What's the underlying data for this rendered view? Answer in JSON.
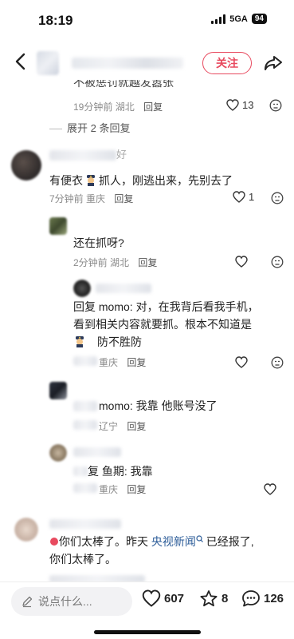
{
  "status": {
    "time": "18:19",
    "network": "5GA",
    "battery": "94"
  },
  "header": {
    "follow_label": "关注"
  },
  "comments": {
    "c0": {
      "text_partial": "不被惩罚就越发嚣张",
      "time": "19分钟前",
      "region": "湖北",
      "reply": "回复",
      "likes": "13"
    },
    "expand": {
      "label": "展开 2 条回复"
    },
    "c1": {
      "user_tail": "好",
      "text_a": "有便衣",
      "text_b": "抓人，刚逃出来，先别去了",
      "time": "7分钟前",
      "region": "重庆",
      "reply": "回复",
      "likes": "1"
    },
    "c2": {
      "text": "还在抓呀?",
      "time": "2分钟前",
      "region": "湖北",
      "reply": "回复"
    },
    "c3": {
      "text_line1": "回复 momo: 对，在我背后看我手机，",
      "text_line2": "看到相关内容就要抓。根本不知道是",
      "text_line3": "防不胜防",
      "region": "重庆",
      "reply": "回复"
    },
    "c4": {
      "text": "momo: 我靠 他账号没了",
      "region": "辽宁",
      "reply": "回复"
    },
    "c5": {
      "text": "复 鱼期: 我靠",
      "region": "重庆",
      "reply": "回复"
    },
    "c6": {
      "text_a": "你们太棒了。昨天 ",
      "link": "央视新闻",
      "text_b": " 已经报了,",
      "text_line2": "你们太棒了。"
    }
  },
  "bottom": {
    "placeholder": "说点什么...",
    "likes": "607",
    "favorites": "8",
    "comments": "126"
  }
}
